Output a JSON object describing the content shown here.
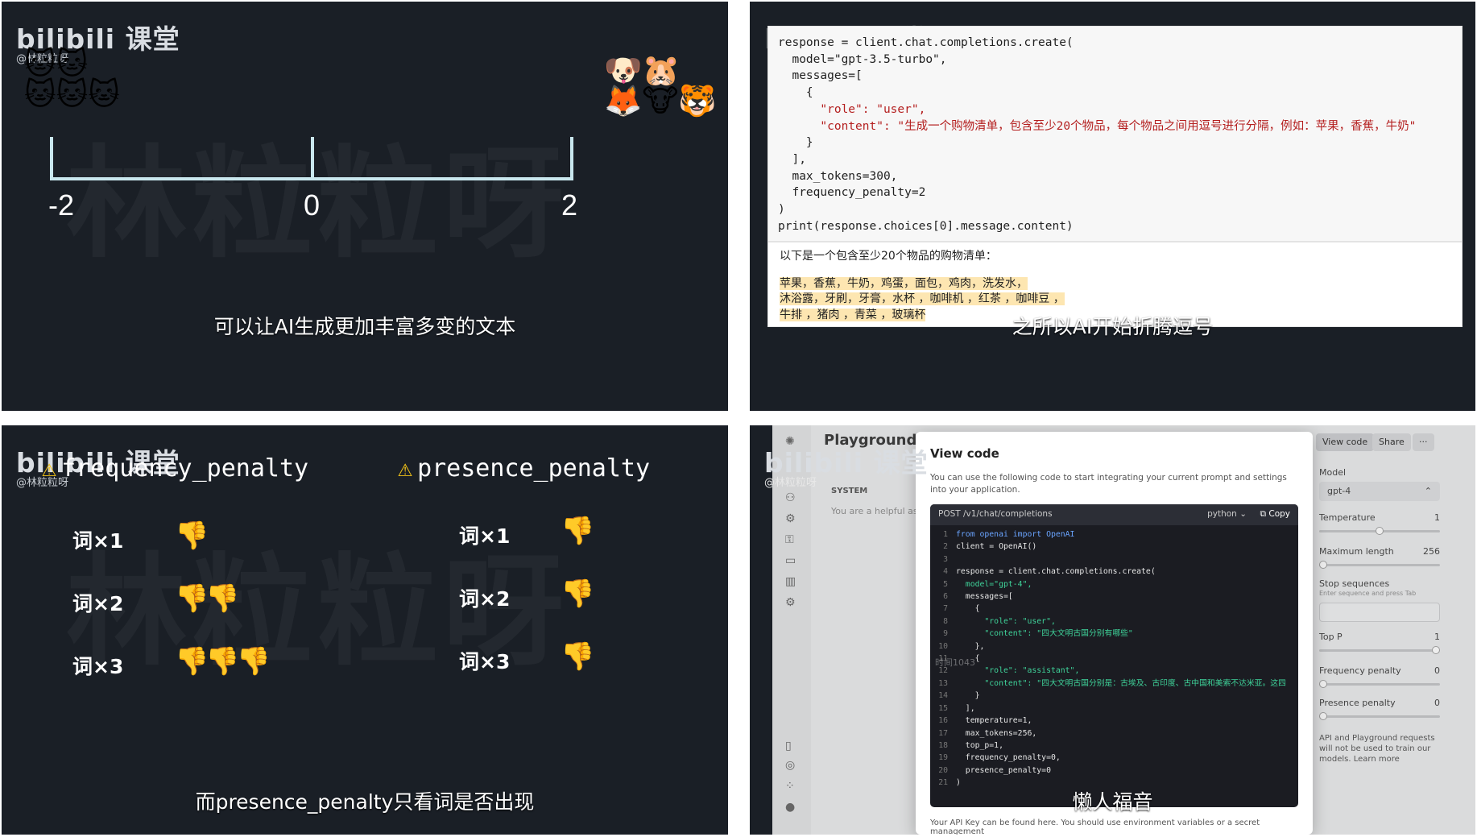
{
  "panel1": {
    "logo": "bilibili 课堂",
    "handle": "@林粒粒呀",
    "watermark": "林粒粒呀",
    "scale": {
      "left": "-2",
      "center": "0",
      "right": "2"
    },
    "subtitle": "可以让AI生成更加丰富多变的文本"
  },
  "panel2": {
    "code_lines": [
      "response = client.chat.completions.create(",
      "  model=\"gpt-3.5-turbo\",",
      "  messages=[",
      "    {",
      "      \"role\": \"user\",",
      "      \"content\": \"生成一个购物清单，包含至少20个物品，每个物品之间用逗号进行分隔，例如：苹果，香蕉，牛奶\"",
      "    }",
      "  ],",
      "  max_tokens=300,",
      "  frequency_penalty=2",
      ")",
      "print(response.choices[0].message.content)"
    ],
    "output_heading": "以下是一个包含至少20个物品的购物清单：",
    "output_lines": [
      "苹果，香蕉，牛奶，鸡蛋，面包，鸡肉，洗发水，",
      "沐浴露，牙刷，牙膏，水杯 ，咖啡机 ，红茶 ，咖啡豆 ，",
      "牛排 ，猪肉 ，青菜 ，玻璃杯"
    ],
    "subtitle": "之所以AI开始折腾逗号"
  },
  "panel3": {
    "logo": "bilibili 课堂",
    "handle": "@林粒粒呀",
    "watermark": "林粒粒呀",
    "left_title": "frequency_penalty",
    "right_title": "presence_penalty",
    "rows": [
      "词×1",
      "词×2",
      "词×3"
    ],
    "subtitle": "而presence_penalty只看词是否出现"
  },
  "panel4": {
    "logo": "bilibili 课堂",
    "handle": "@林粒粒呀",
    "playground_title": "Playground",
    "view_code_btn": "View code",
    "share_btn": "Share",
    "more_btn": "···",
    "system_label": "SYSTEM",
    "system_placeholder": "You are a helpful as",
    "modal_title": "View code",
    "modal_desc": "You can use the following code to start integrating your current prompt and settings into your application.",
    "endpoint": "POST /v1/chat/completions",
    "language": "python",
    "copy_label": "Copy",
    "code": [
      "from openai import OpenAI",
      "client = OpenAI()",
      "",
      "response = client.chat.completions.create(",
      "  model=\"gpt-4\",",
      "  messages=[",
      "    {",
      "      \"role\": \"user\",",
      "      \"content\": \"四大文明古国分别有哪些\"",
      "    },",
      "    {",
      "      \"role\": \"assistant\",",
      "      \"content\": \"四大文明古国分别是：古埃及、古印度、古中国和美索不达米亚。这四",
      "    }",
      "  ],",
      "  temperature=1,",
      "  max_tokens=256,",
      "  top_p=1,",
      "  frequency_penalty=0,",
      "  presence_penalty=0",
      ")"
    ],
    "side": {
      "model_label": "Model",
      "model_value": "gpt-4",
      "temperature_label": "Temperature",
      "temperature_value": "1",
      "max_length_label": "Maximum length",
      "max_length_value": "256",
      "stop_label": "Stop sequences",
      "stop_hint": "Enter sequence and press Tab",
      "top_p_label": "Top P",
      "top_p_value": "1",
      "freq_label": "Frequency penalty",
      "freq_value": "0",
      "presence_label": "Presence penalty",
      "presence_value": "0",
      "note": "API and Playground requests will not be used to train our models. Learn more"
    },
    "footer_text": "Your API Key can be found here. You should use environment variables or a secret management",
    "subtitle": "懒人福音",
    "timestamp": "时间1043"
  }
}
